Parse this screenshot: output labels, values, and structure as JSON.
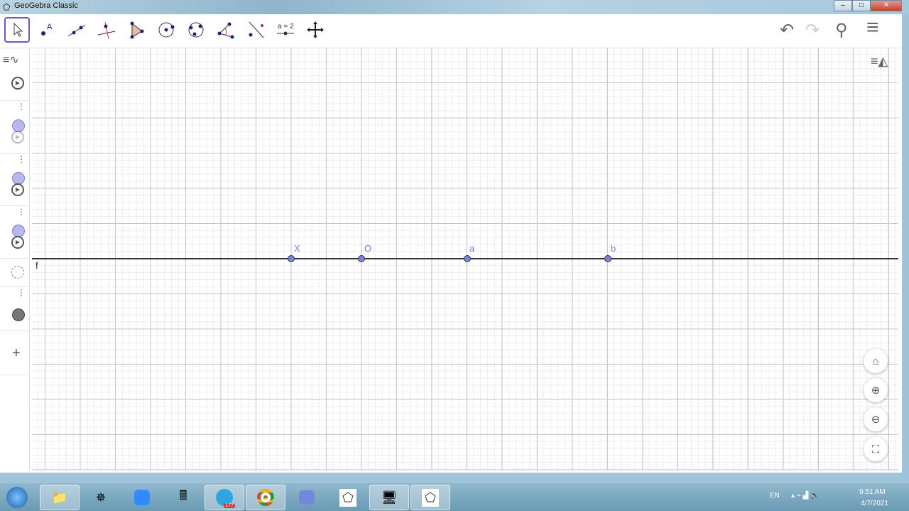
{
  "window": {
    "title": "GeoGebra Classic",
    "minimize": "–",
    "maximize": "□",
    "close": "✕"
  },
  "toolbar": {
    "tools": [
      {
        "name": "move-tool"
      },
      {
        "name": "point-tool"
      },
      {
        "name": "line-tool"
      },
      {
        "name": "perpendicular-line-tool"
      },
      {
        "name": "polygon-tool"
      },
      {
        "name": "circle-center-point-tool"
      },
      {
        "name": "circle-three-points-tool"
      },
      {
        "name": "angle-tool"
      },
      {
        "name": "reflect-tool"
      },
      {
        "name": "slider-tool",
        "label": "a = 2"
      },
      {
        "name": "move-graphics-view-tool"
      }
    ],
    "undo": "↶",
    "redo": "↷",
    "search": "⚲",
    "menu": "≡"
  },
  "graphics": {
    "line_label": "f",
    "points": [
      {
        "label": "X"
      },
      {
        "label": "O"
      },
      {
        "label": "a"
      },
      {
        "label": "b"
      }
    ],
    "home": "⌂",
    "zoom_in": "⊕",
    "zoom_out": "⊖",
    "fullscreen": "⛶"
  },
  "algebra": {
    "add": "+",
    "menu_dots": "⋮",
    "play": "▶"
  },
  "taskbar": {
    "items": [
      "start",
      "file-explorer",
      "game",
      "zoom",
      "calculator",
      "telegram",
      "chrome",
      "discord",
      "geogebra",
      "computer",
      "geogebra"
    ],
    "telegram_badge": "177",
    "lang": "EN",
    "time": "9:51 AM",
    "date": "4/7/2021"
  },
  "colors": {
    "point": "#7b7fe0",
    "accent": "#6557d2"
  }
}
